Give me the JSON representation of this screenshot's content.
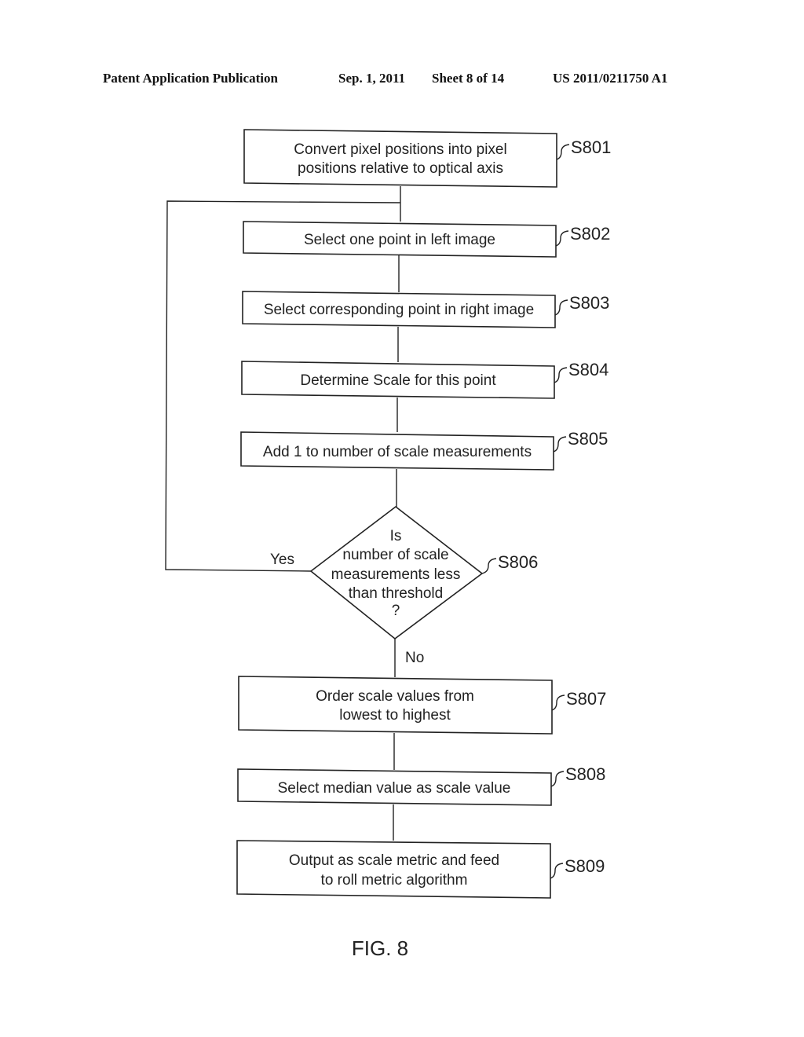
{
  "header": {
    "publication": "Patent Application Publication",
    "date": "Sep. 1, 2011",
    "sheet": "Sheet 8 of 14",
    "number": "US 2011/0211750 A1"
  },
  "steps": [
    {
      "id": "S801",
      "lines": [
        "Convert pixel positions into pixel",
        "positions relative to optical axis"
      ]
    },
    {
      "id": "S802",
      "lines": [
        "Select one point in left image"
      ]
    },
    {
      "id": "S803",
      "lines": [
        "Select corresponding point in right image"
      ]
    },
    {
      "id": "S804",
      "lines": [
        "Determine Scale for this point"
      ]
    },
    {
      "id": "S805",
      "lines": [
        "Add 1 to number of scale measurements"
      ]
    },
    {
      "id": "S806",
      "lines": [
        "Is",
        "number of scale",
        "measurements less",
        "than threshold",
        "?"
      ]
    },
    {
      "id": "S807",
      "lines": [
        "Order scale values from",
        "lowest to highest"
      ]
    },
    {
      "id": "S808",
      "lines": [
        "Select median value as scale value"
      ]
    },
    {
      "id": "S809",
      "lines": [
        "Output as scale metric and feed",
        "to roll metric algorithm"
      ]
    }
  ],
  "edges": {
    "yes_label": "Yes",
    "no_label": "No"
  },
  "figure": {
    "caption": "FIG. 8"
  }
}
